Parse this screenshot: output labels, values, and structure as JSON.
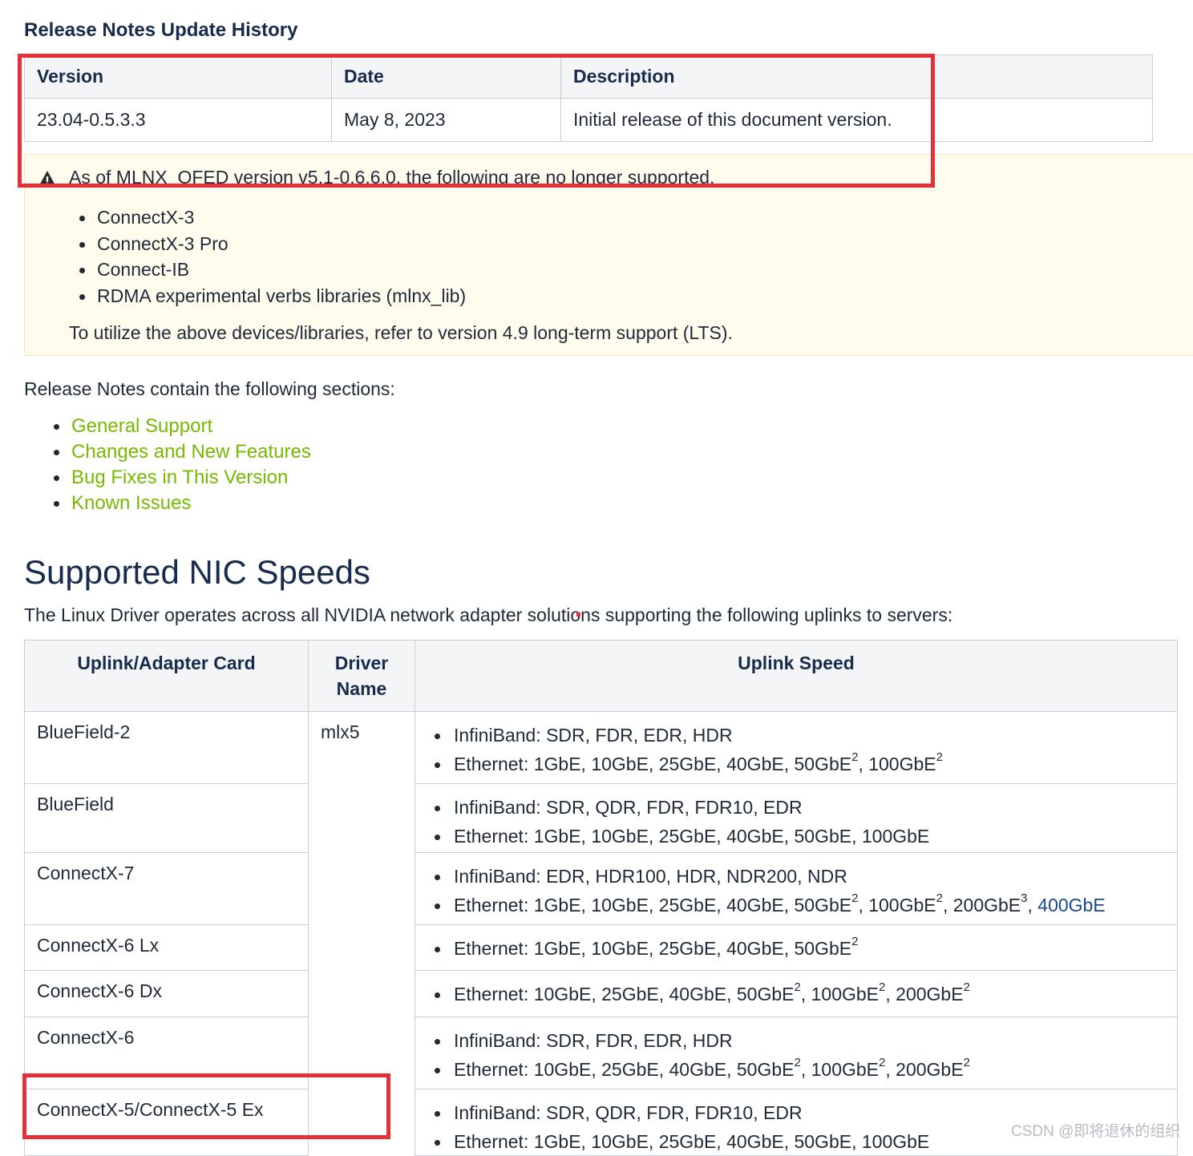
{
  "update_history": {
    "title": "Release Notes Update History",
    "headers": [
      "Version",
      "Date",
      "Description"
    ],
    "rows": [
      [
        "23.04-0.5.3.3",
        "May 8, 2023",
        "Initial release of this document version."
      ]
    ]
  },
  "warning": {
    "icon": "warning-icon",
    "text": "As of MLNX_OFED version v5.1-0.6.6.0, the following are no longer supported.",
    "items": [
      "ConnectX-3",
      "ConnectX-3 Pro",
      "Connect-IB",
      "RDMA experimental verbs libraries (mlnx_lib)"
    ],
    "note": "To utilize the above devices/libraries, refer to version 4.9 long-term support (LTS)."
  },
  "sections": {
    "intro": "Release Notes contain the following sections:",
    "links": [
      "General Support",
      "Changes and New Features",
      "Bug Fixes in This Version",
      "Known Issues"
    ],
    "link_color": "#76b900"
  },
  "nic_speeds": {
    "heading": "Supported NIC Speeds",
    "intro": "The Linux Driver operates across all NVIDIA network adapter solutions supporting the following uplinks to servers:",
    "headers": {
      "card": "Uplink/Adapter Card",
      "driver_line1": "Driver",
      "driver_line2": "Name",
      "speed": "Uplink Speed"
    },
    "driver_name": "mlx5",
    "rows": [
      {
        "card": "BlueField-2",
        "infiniband": "InfiniBand: SDR, FDR, EDR, HDR",
        "ethernet": [
          [
            "Ethernet: 1GbE, 10GbE, 25GbE, 40GbE, 50GbE",
            "2"
          ],
          [
            ", 100GbE",
            "2"
          ]
        ]
      },
      {
        "card": "BlueField",
        "infiniband": "InfiniBand: SDR, QDR, FDR, FDR10, EDR",
        "ethernet": [
          [
            "Ethernet: 1GbE, 10GbE, 25GbE, 40GbE, 50GbE, 100GbE",
            ""
          ]
        ]
      },
      {
        "card": "ConnectX-7",
        "infiniband": "InfiniBand: EDR, HDR100, HDR, NDR200, NDR",
        "ethernet": [
          [
            "Ethernet: 1GbE, 10GbE, 25GbE, 40GbE, 50GbE",
            "2"
          ],
          [
            ", 100GbE",
            "2"
          ],
          [
            ", 200GbE",
            "3"
          ],
          [
            ", ",
            ""
          ]
        ],
        "ethernet_link": "400GbE"
      },
      {
        "card": "ConnectX-6 Lx",
        "infiniband": "",
        "ethernet": [
          [
            "Ethernet: 1GbE, 10GbE, 25GbE, 40GbE, 50GbE",
            "2"
          ]
        ]
      },
      {
        "card": "ConnectX-6 Dx",
        "infiniband": "",
        "ethernet": [
          [
            "Ethernet: 10GbE, 25GbE, 40GbE, 50GbE",
            "2"
          ],
          [
            ", 100GbE",
            "2"
          ],
          [
            ", 200GbE",
            "2"
          ]
        ]
      },
      {
        "card": "ConnectX-6",
        "infiniband": "InfiniBand: SDR, FDR, EDR, HDR",
        "ethernet": [
          [
            "Ethernet: 10GbE, 25GbE, 40GbE, 50GbE",
            "2"
          ],
          [
            ", 100GbE",
            "2"
          ],
          [
            ", 200GbE",
            "2"
          ]
        ]
      },
      {
        "card": "ConnectX-5/ConnectX-5 Ex",
        "infiniband": "InfiniBand: SDR, QDR, FDR, FDR10, EDR",
        "ethernet": [
          [
            "Ethernet: 1GbE, 10GbE, 25GbE, 40GbE, 50GbE, 100GbE",
            ""
          ]
        ]
      }
    ]
  },
  "annotation_color": "#e5303a",
  "watermark": "CSDN @即将退休的组织"
}
